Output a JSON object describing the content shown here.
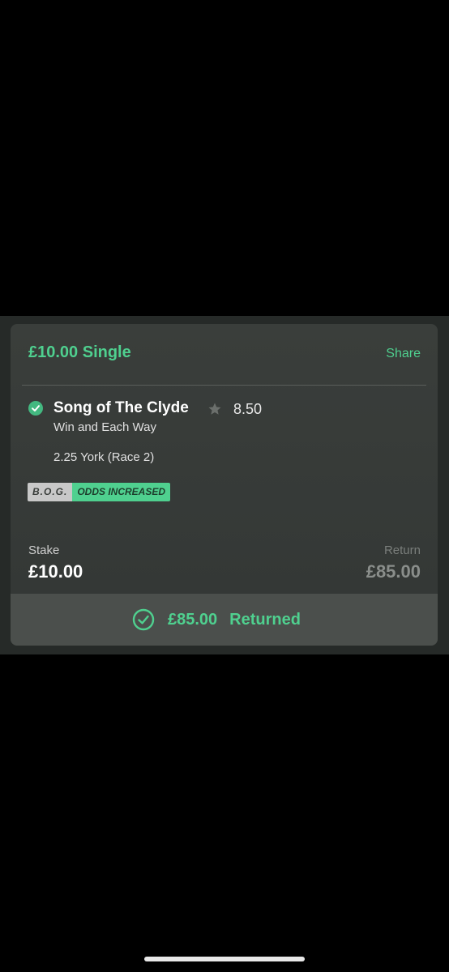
{
  "bet": {
    "title": "£10.00 Single",
    "share_label": "Share",
    "selection": {
      "name": "Song of The Clyde",
      "odds": "8.50",
      "market": "Win and Each Way",
      "event": "2.25 York (Race 2)"
    },
    "badges": {
      "bog": "B.O.G.",
      "odds_increased": "ODDS INCREASED"
    },
    "stake": {
      "label": "Stake",
      "value": "£10.00"
    },
    "return": {
      "label": "Return",
      "value": "£85.00"
    },
    "result": {
      "amount": "£85.00",
      "status": "Returned"
    }
  },
  "icons": {
    "selection_status": "check-circle-icon",
    "favourite": "star-icon",
    "result_status": "check-circle-outline-icon"
  },
  "colors": {
    "accent": "#4fd08f",
    "background": "#000000",
    "card": "#3a3e3b",
    "result_bar": "#4b4f4c"
  }
}
